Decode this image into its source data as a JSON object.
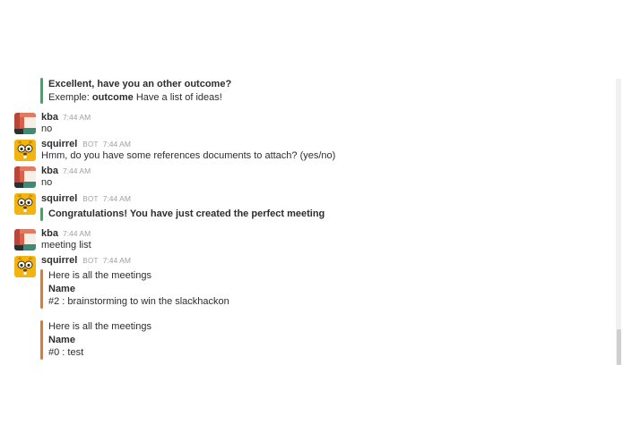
{
  "colors": {
    "green_bar": "#3da865",
    "orange_bar": "#e07a2e",
    "meta_gray": "#9e9ea6",
    "text": "#2c2d30"
  },
  "top_attachment": {
    "title": "Excellent, have you an other outcome?",
    "example_prefix": "Exemple: ",
    "example_keyword": "outcome",
    "example_suffix": " Have a list of ideas!"
  },
  "messages": [
    {
      "author": "kba",
      "time": "7:44 AM",
      "text": "no",
      "avatar_icon": "kba-avatar-icon"
    },
    {
      "author": "squirrel",
      "bot_label": "BOT",
      "time": "7:44 AM",
      "text": "Hmm, do you have some references documents to attach? (yes/no)",
      "avatar_icon": "squirrel-avatar-icon"
    },
    {
      "author": "kba",
      "time": "7:44 AM",
      "text": "no",
      "avatar_icon": "kba-avatar-icon"
    },
    {
      "author": "squirrel",
      "bot_label": "BOT",
      "time": "7:44 AM",
      "attachment_title": "Congratulations! You have just created the perfect meeting",
      "avatar_icon": "squirrel-avatar-icon"
    },
    {
      "author": "kba",
      "time": "7:44 AM",
      "text": "meeting list",
      "avatar_icon": "kba-avatar-icon"
    },
    {
      "author": "squirrel",
      "bot_label": "BOT",
      "time": "7:44 AM",
      "avatar_icon": "squirrel-avatar-icon",
      "attachments": [
        {
          "header": "Here is all the meetings",
          "field_title": "Name",
          "field_value": "#2 : brainstorming to win the slackhackon"
        },
        {
          "header": "Here is all the meetings",
          "field_title": "Name",
          "field_value": "#0 : test"
        }
      ]
    }
  ]
}
